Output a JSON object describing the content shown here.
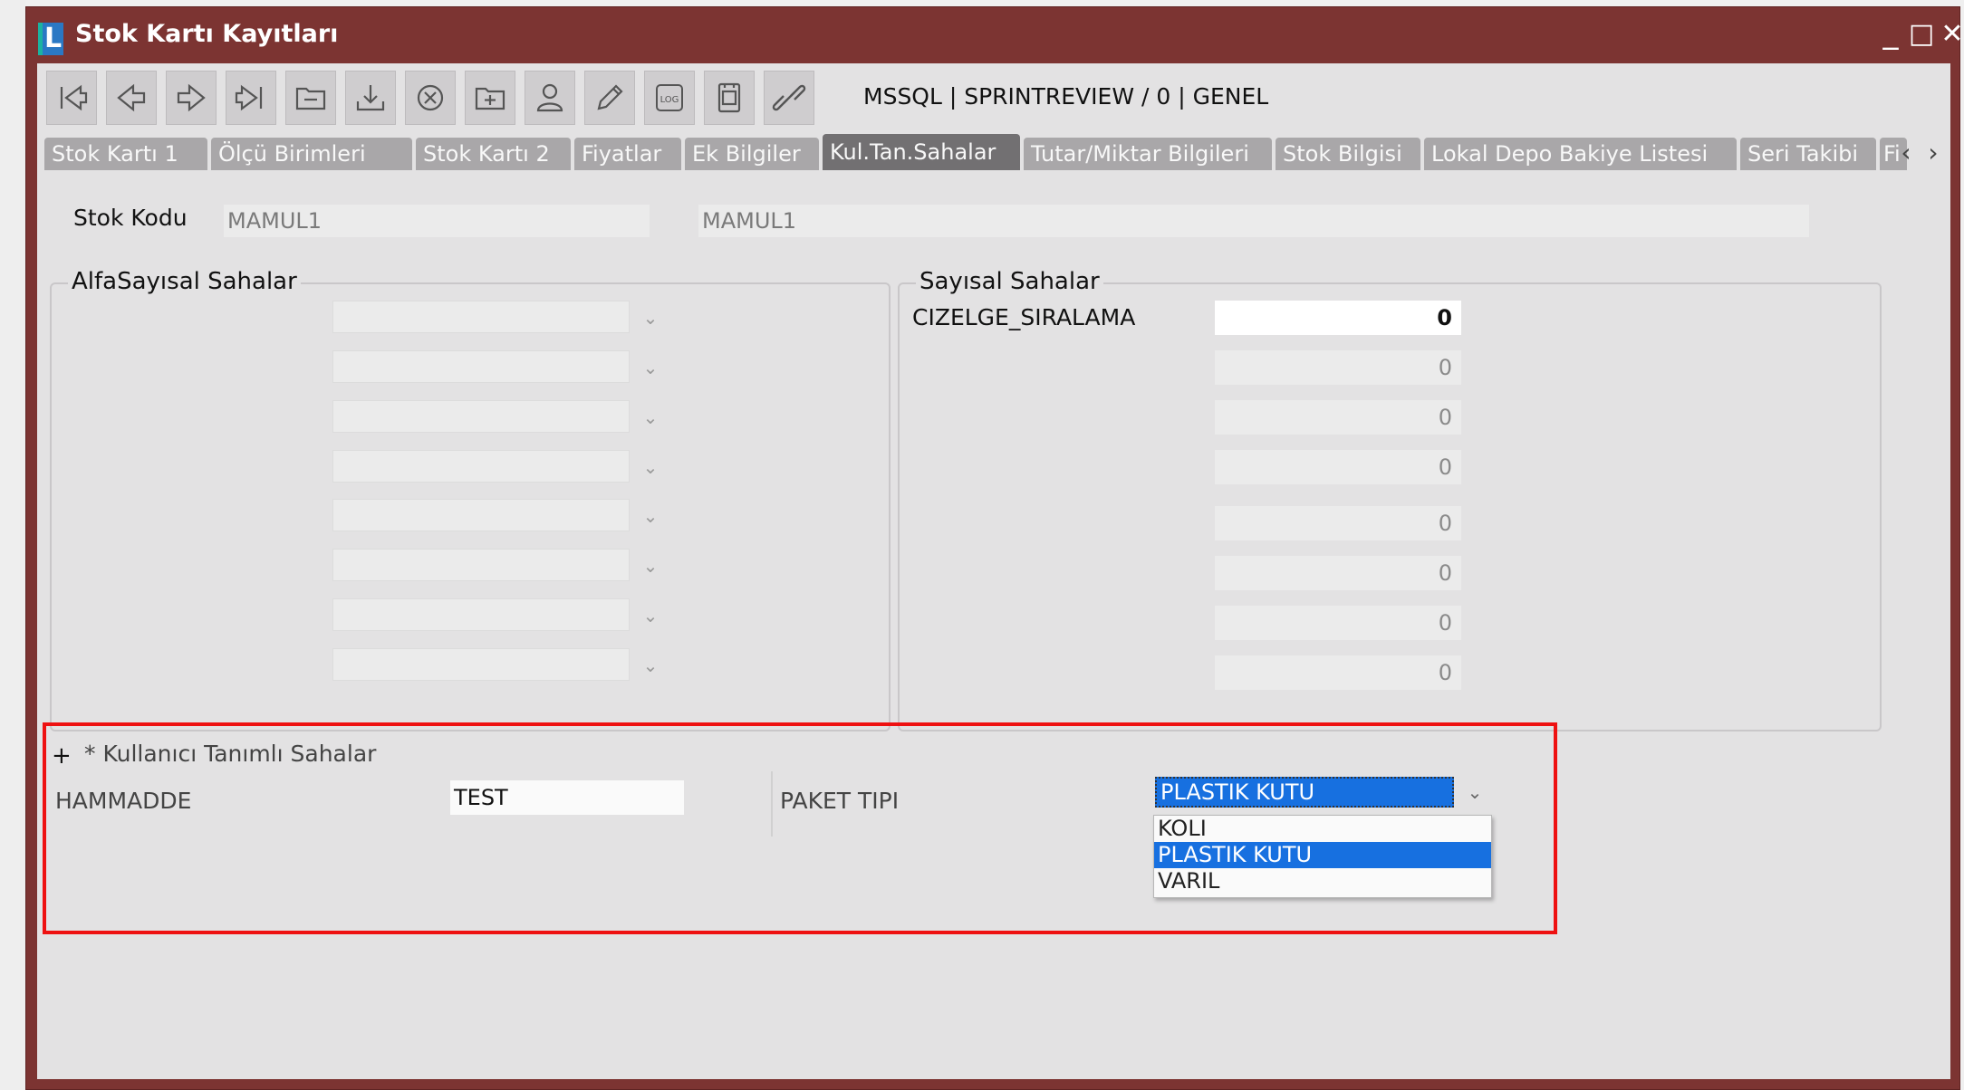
{
  "window": {
    "title": "Stok Kartı Kayıtları",
    "logo_letter": "L",
    "minimize": "_",
    "maximize": "□",
    "close": "✕"
  },
  "toolbar": {
    "buttons": [
      "first-record-icon",
      "previous-record-icon",
      "next-record-icon",
      "last-record-icon",
      "folder-icon",
      "download-icon",
      "cancel-icon",
      "new-record-icon",
      "user-icon",
      "edit-pencil-icon",
      "log-icon",
      "document-icon",
      "link-icon"
    ],
    "connection_info": "MSSQL | SPRINTREVIEW / 0 | GENEL"
  },
  "tabs": [
    {
      "label": "Stok Kartı 1"
    },
    {
      "label": "Ölçü Birimleri"
    },
    {
      "label": "Stok Kartı 2"
    },
    {
      "label": "Fiyatlar"
    },
    {
      "label": "Ek Bilgiler"
    },
    {
      "label": "Kul.Tan.Sahalar"
    },
    {
      "label": "Tutar/Miktar Bilgileri"
    },
    {
      "label": "Stok Bilgisi"
    },
    {
      "label": "Lokal Depo Bakiye Listesi"
    },
    {
      "label": "Seri Takibi"
    },
    {
      "label": "Fi"
    }
  ],
  "tab_scroll": {
    "left": "‹",
    "right": "›"
  },
  "stock": {
    "label": "Stok Kodu",
    "code": "MAMUL1",
    "name": "MAMUL1"
  },
  "alpha_group": {
    "title": "AlfaSayısal Sahalar"
  },
  "numeric_group": {
    "title": "Sayısal Sahalar",
    "first_label": "CIZELGE_SIRALAMA",
    "values": [
      "0",
      "0",
      "0",
      "0",
      "0",
      "0",
      "0",
      "0"
    ]
  },
  "user_defined": {
    "expand": "+",
    "title": "* Kullanıcı Tanımlı Sahalar",
    "hammadde_label": "HAMMADDE",
    "hammadde_value": "TEST",
    "paket_label": "PAKET TIPI",
    "paket_value": "PLASTIK KUTU",
    "options": [
      "KOLI",
      "PLASTIK KUTU",
      "VARIL"
    ],
    "selected_index": 1
  },
  "colors": {
    "title_bar": "#7c3432",
    "client_bg": "#e3e2e3",
    "selection": "#1770e0",
    "highlight_border": "#ee1111"
  }
}
